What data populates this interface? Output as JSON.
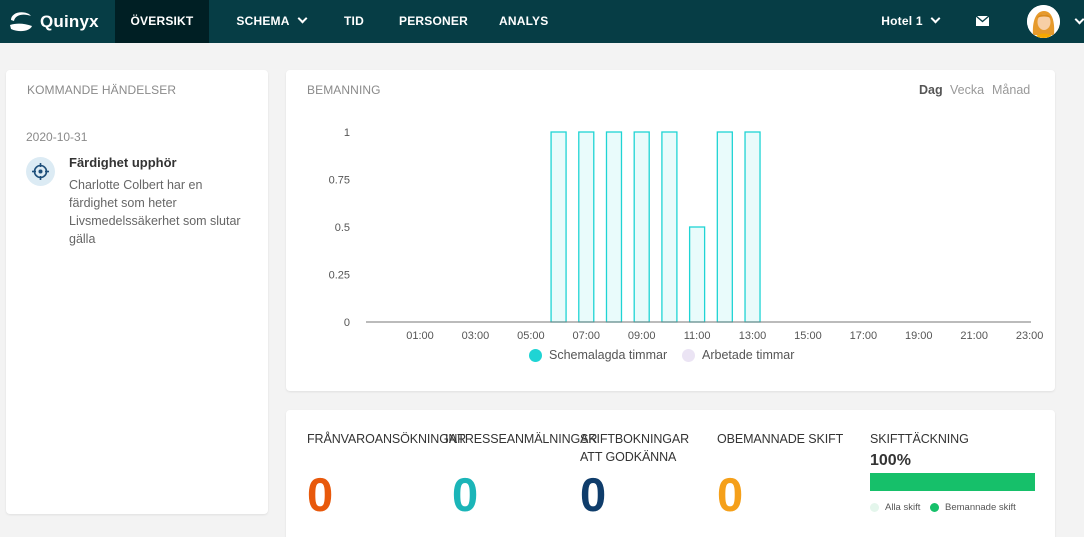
{
  "nav": {
    "brand": "Quinyx",
    "items": [
      "ÖVERSIKT",
      "SCHEMA",
      "TID",
      "PERSONER",
      "ANALYS"
    ],
    "unit": "Hotel 1"
  },
  "events": {
    "title": "KOMMANDE HÄNDELSER",
    "date": "2020-10-31",
    "item_title": "Färdighet upphör",
    "item_desc": "Charlotte Colbert har en färdighet som heter Livsmedelssäkerhet som slutar gälla"
  },
  "staffing": {
    "title": "BEMANNING",
    "ranges": [
      "Dag",
      "Vecka",
      "Månad"
    ]
  },
  "chart_data": {
    "type": "bar",
    "x": [
      "00:00",
      "01:00",
      "02:00",
      "03:00",
      "04:00",
      "05:00",
      "06:00",
      "07:00",
      "08:00",
      "09:00",
      "10:00",
      "11:00",
      "12:00",
      "13:00",
      "14:00",
      "15:00",
      "16:00",
      "17:00",
      "18:00",
      "19:00",
      "20:00",
      "21:00",
      "22:00",
      "23:00"
    ],
    "xticks": [
      "01:00",
      "03:00",
      "05:00",
      "07:00",
      "09:00",
      "11:00",
      "13:00",
      "15:00",
      "17:00",
      "19:00",
      "21:00",
      "23:00"
    ],
    "yticks": [
      "0",
      "0.25",
      "0.5",
      "0.75",
      "1"
    ],
    "ylim": [
      0,
      1
    ],
    "series": [
      {
        "name": "Schemalagda timmar",
        "color": "#1fd4d4",
        "values": [
          0,
          0,
          0,
          0,
          0,
          0,
          1,
          1,
          1,
          1,
          1,
          0.5,
          1,
          1,
          0,
          0,
          0,
          0,
          0,
          0,
          0,
          0,
          0,
          0
        ]
      },
      {
        "name": "Arbetade timmar",
        "color": "#ebe4f4",
        "values": [
          0,
          0,
          0,
          0,
          0,
          0,
          0,
          0,
          0,
          0,
          0,
          0,
          0,
          0,
          0,
          0,
          0,
          0,
          0,
          0,
          0,
          0,
          0,
          0
        ]
      }
    ]
  },
  "stats": [
    {
      "label": "FRÅNVAROANSÖKNINGAR",
      "value": "0",
      "color": "#e8590c"
    },
    {
      "label": "INTRESSEANMÄLNINGAR",
      "value": "0",
      "color": "#1bb5b8"
    },
    {
      "label": "SKIFTBOKNINGAR ATT GODKÄNNA",
      "value": "0",
      "color": "#0f3d6b"
    },
    {
      "label": "OBEMANNADE SKIFT",
      "value": "0",
      "color": "#f5a01a"
    }
  ],
  "coverage": {
    "label": "SKIFTTÄCKNING",
    "value": "100%",
    "fraction": 1.0,
    "legend": [
      "Alla skift",
      "Bemannade skift"
    ],
    "colors": [
      "#e4f6ec",
      "#16c06a"
    ]
  }
}
